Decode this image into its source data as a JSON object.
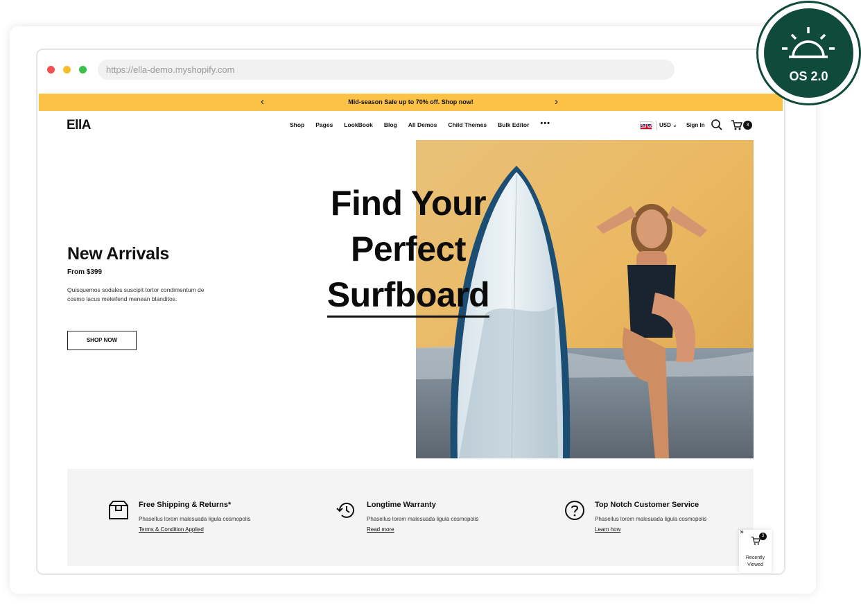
{
  "browser": {
    "url": "https://ella-demo.myshopify.com"
  },
  "promo": {
    "text": "Mid-season Sale up to 70% off. Shop now!",
    "prev": "‹",
    "next": "›"
  },
  "header": {
    "logo": "EllA",
    "nav": [
      "Shop",
      "Pages",
      "LookBook",
      "Blog",
      "All Demos",
      "Child Themes",
      "Bulk Editor"
    ],
    "more": "•••",
    "currency": "USD ⌄",
    "signin": "Sign In",
    "cart_count": "3"
  },
  "hero": {
    "left_title": "New Arrivals",
    "price": "From $399",
    "description": "Quisquemos sodales suscipit tortor condimentum de cosmo lacus meleifend menean blanditos.",
    "button": "SHOP NOW",
    "headline_1": "Find Your",
    "headline_2": "Perfect",
    "headline_3": "Surfboard"
  },
  "features": [
    {
      "title": "Free Shipping & Returns*",
      "desc": "Phasellus lorem malesuada ligula cosmopolis",
      "link": "Terms & Condition Applied",
      "icon": "box-icon"
    },
    {
      "title": "Longtime Warranty",
      "desc": "Phasellus lorem malesuada ligula cosmopolis",
      "link": "Read more",
      "icon": "history-icon"
    },
    {
      "title": "Top Notch Customer Service",
      "desc": "Phasellus lorem malesuada ligula cosmopolis",
      "link": "Learn how",
      "icon": "question-icon"
    }
  ],
  "recently_viewed": {
    "label_1": "Recently",
    "label_2": "Viewed",
    "count": "3",
    "collapse": "»"
  },
  "os_badge": {
    "text": "OS 2.0"
  },
  "colors": {
    "promo_bg": "#fcc246",
    "badge_green": "#0f4a3b",
    "features_bg": "#f4f4f4"
  }
}
